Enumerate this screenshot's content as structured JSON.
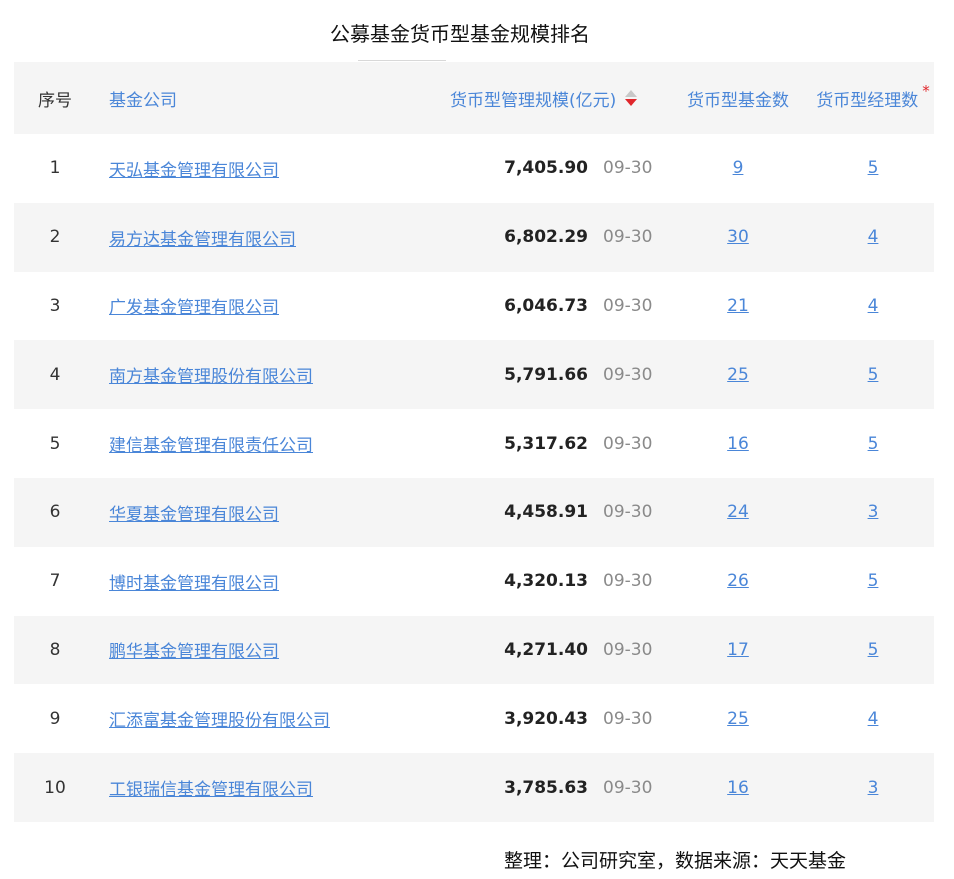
{
  "title": "公募基金货币型基金规模排名",
  "table": {
    "headers": {
      "rank": "序号",
      "company": "基金公司",
      "scale": "货币型管理规模(亿元)",
      "fund_count": "货币型基金数",
      "manager_count": "货币型经理数",
      "required_mark": "*"
    },
    "rows": [
      {
        "rank": "1",
        "company": "天弘基金管理有限公司",
        "scale": "7,405.90",
        "date": "09-30",
        "fund_count": "9",
        "manager_count": "5"
      },
      {
        "rank": "2",
        "company": "易方达基金管理有限公司",
        "scale": "6,802.29",
        "date": "09-30",
        "fund_count": "30",
        "manager_count": "4"
      },
      {
        "rank": "3",
        "company": "广发基金管理有限公司",
        "scale": "6,046.73",
        "date": "09-30",
        "fund_count": "21",
        "manager_count": "4"
      },
      {
        "rank": "4",
        "company": "南方基金管理股份有限公司",
        "scale": "5,791.66",
        "date": "09-30",
        "fund_count": "25",
        "manager_count": "5"
      },
      {
        "rank": "5",
        "company": "建信基金管理有限责任公司",
        "scale": "5,317.62",
        "date": "09-30",
        "fund_count": "16",
        "manager_count": "5"
      },
      {
        "rank": "6",
        "company": "华夏基金管理有限公司",
        "scale": "4,458.91",
        "date": "09-30",
        "fund_count": "24",
        "manager_count": "3"
      },
      {
        "rank": "7",
        "company": "博时基金管理有限公司",
        "scale": "4,320.13",
        "date": "09-30",
        "fund_count": "26",
        "manager_count": "5"
      },
      {
        "rank": "8",
        "company": "鹏华基金管理有限公司",
        "scale": "4,271.40",
        "date": "09-30",
        "fund_count": "17",
        "manager_count": "5"
      },
      {
        "rank": "9",
        "company": "汇添富基金管理股份有限公司",
        "scale": "3,920.43",
        "date": "09-30",
        "fund_count": "25",
        "manager_count": "4"
      },
      {
        "rank": "10",
        "company": "工银瑞信基金管理有限公司",
        "scale": "3,785.63",
        "date": "09-30",
        "fund_count": "16",
        "manager_count": "3"
      }
    ]
  },
  "footer": "整理：公司研究室，数据来源：天天基金",
  "colors": {
    "link": "#4a86d8",
    "sort_active": "#e0262b",
    "row_alt": "#f5f5f5"
  }
}
